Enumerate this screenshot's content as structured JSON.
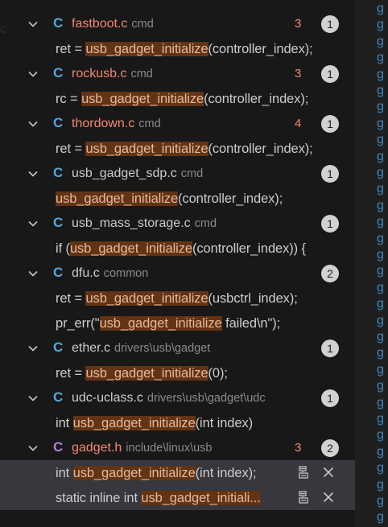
{
  "gutter_glyph": "g",
  "colors": {
    "file_modified": "#f48771",
    "file_normal": "#cccccc",
    "file_dir": "#8b8b8b",
    "match_highlight_bg": "#623315",
    "c_icon": "#4fa9dc",
    "h_icon": "#b180d7",
    "badge_bg": "#d1d1d1",
    "selected_row": "#37373d"
  },
  "results": [
    {
      "file": "fastboot.c",
      "dir": "cmd",
      "icon_letter": "C",
      "icon_type": "c-file-icon",
      "modified": true,
      "changes": "3",
      "count": "1",
      "matches": [
        {
          "before": "ret = ",
          "match": "usb_gadget_initialize",
          "after": "(controller_index);"
        }
      ]
    },
    {
      "file": "rockusb.c",
      "dir": "cmd",
      "icon_letter": "C",
      "icon_type": "c-file-icon",
      "modified": true,
      "changes": "3",
      "count": "1",
      "matches": [
        {
          "before": "rc = ",
          "match": "usb_gadget_initialize",
          "after": "(controller_index);"
        }
      ]
    },
    {
      "file": "thordown.c",
      "dir": "cmd",
      "icon_letter": "C",
      "icon_type": "c-file-icon",
      "modified": true,
      "changes": "4",
      "count": "1",
      "matches": [
        {
          "before": "ret = ",
          "match": "usb_gadget_initialize",
          "after": "(controller_index);"
        }
      ]
    },
    {
      "file": "usb_gadget_sdp.c",
      "dir": "cmd",
      "icon_letter": "C",
      "icon_type": "c-file-icon",
      "modified": false,
      "changes": "",
      "count": "1",
      "matches": [
        {
          "before": "",
          "match": "usb_gadget_initialize",
          "after": "(controller_index);"
        }
      ]
    },
    {
      "file": "usb_mass_storage.c",
      "dir": "cmd",
      "icon_letter": "C",
      "icon_type": "c-file-icon",
      "modified": false,
      "changes": "",
      "count": "1",
      "matches": [
        {
          "before": "if (",
          "match": "usb_gadget_initialize",
          "after": "(controller_index)) {"
        }
      ]
    },
    {
      "file": "dfu.c",
      "dir": "common",
      "icon_letter": "C",
      "icon_type": "c-file-icon",
      "modified": false,
      "changes": "",
      "count": "2",
      "matches": [
        {
          "before": "ret = ",
          "match": "usb_gadget_initialize",
          "after": "(usbctrl_index);"
        },
        {
          "before": "pr_err(\"",
          "match": "usb_gadget_initialize",
          "after": " failed\\n\");"
        }
      ]
    },
    {
      "file": "ether.c",
      "dir": "drivers\\usb\\gadget",
      "icon_letter": "C",
      "icon_type": "c-file-icon",
      "modified": false,
      "changes": "",
      "count": "1",
      "matches": [
        {
          "before": "ret = ",
          "match": "usb_gadget_initialize",
          "after": "(0);"
        }
      ]
    },
    {
      "file": "udc-uclass.c",
      "dir": "drivers\\usb\\gadget\\udc",
      "icon_letter": "C",
      "icon_type": "c-file-icon",
      "modified": false,
      "changes": "",
      "count": "1",
      "matches": [
        {
          "before": "int ",
          "match": "usb_gadget_initialize",
          "after": "(int index)"
        }
      ]
    },
    {
      "file": "gadget.h",
      "dir": "include\\linux\\usb",
      "icon_letter": "C",
      "icon_type": "h-file-icon",
      "modified": true,
      "changes": "3",
      "count": "2",
      "matches": [
        {
          "before": "int ",
          "match": "usb_gadget_initialize",
          "after": "(int index);",
          "selected": true
        },
        {
          "before": "static inline int ",
          "match": "usb_gadget_initiali...",
          "after": "",
          "selected": true
        }
      ]
    }
  ]
}
